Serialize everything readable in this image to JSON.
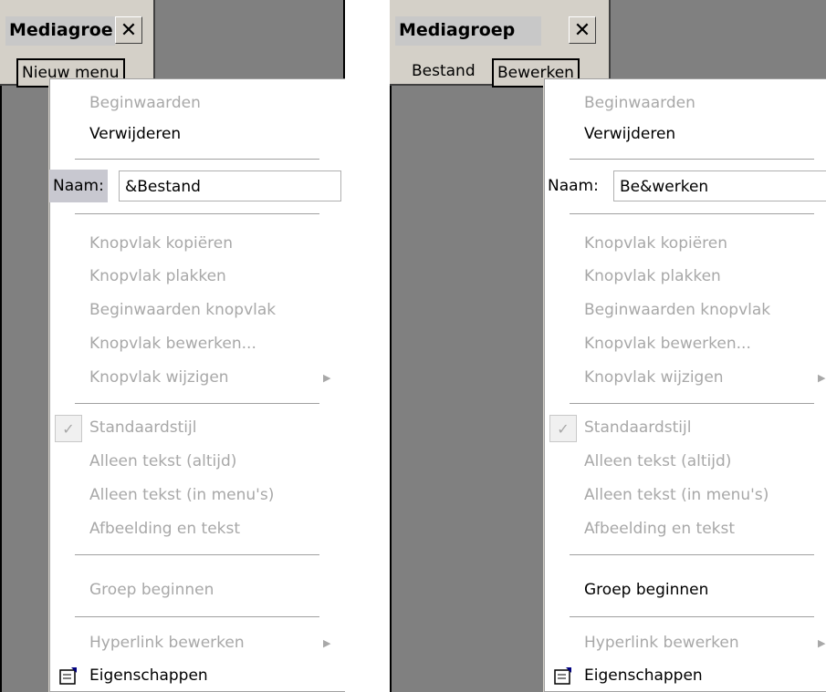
{
  "left": {
    "toolbar_title": "Mediagroe",
    "close_label": "✕",
    "top_item": "Nieuw menu",
    "menu": {
      "reset": "Beginwaarden",
      "delete": "Verwijderen",
      "name_label": "Naam:",
      "name_value": "&Bestand",
      "copy_image": "Knopvlak kopiëren",
      "paste_image": "Knopvlak plakken",
      "reset_image": "Beginwaarden knopvlak",
      "edit_image": "Knopvlak bewerken...",
      "change_image": "Knopvlak wijzigen",
      "default_style": "Standaardstijl",
      "text_only_always": "Alleen tekst (altijd)",
      "text_only_menus": "Alleen tekst (in menu's)",
      "image_and_text": "Afbeelding en tekst",
      "begin_group": "Groep beginnen",
      "edit_hyperlink": "Hyperlink bewerken",
      "properties": "Eigenschappen"
    }
  },
  "right": {
    "toolbar_title": "Mediagroep",
    "close_label": "✕",
    "top_item_1": "Bestand",
    "top_item_2": "Bewerken",
    "menu": {
      "reset": "Beginwaarden",
      "delete": "Verwijderen",
      "name_label": "Naam:",
      "name_value": "Be&werken",
      "copy_image": "Knopvlak kopiëren",
      "paste_image": "Knopvlak plakken",
      "reset_image": "Beginwaarden knopvlak",
      "edit_image": "Knopvlak bewerken...",
      "change_image": "Knopvlak wijzigen",
      "default_style": "Standaardstijl",
      "text_only_always": "Alleen tekst (altijd)",
      "text_only_menus": "Alleen tekst (in menu's)",
      "image_and_text": "Afbeelding en tekst",
      "begin_group": "Groep beginnen",
      "edit_hyperlink": "Hyperlink bewerken",
      "properties": "Eigenschappen"
    }
  },
  "colors": {
    "disabled_text": "#a8a8a8",
    "desktop": "#808080",
    "toolbar": "#d4d0c8"
  },
  "icons": [
    "close-icon",
    "check-icon",
    "submenu-arrow-icon",
    "properties-icon"
  ]
}
